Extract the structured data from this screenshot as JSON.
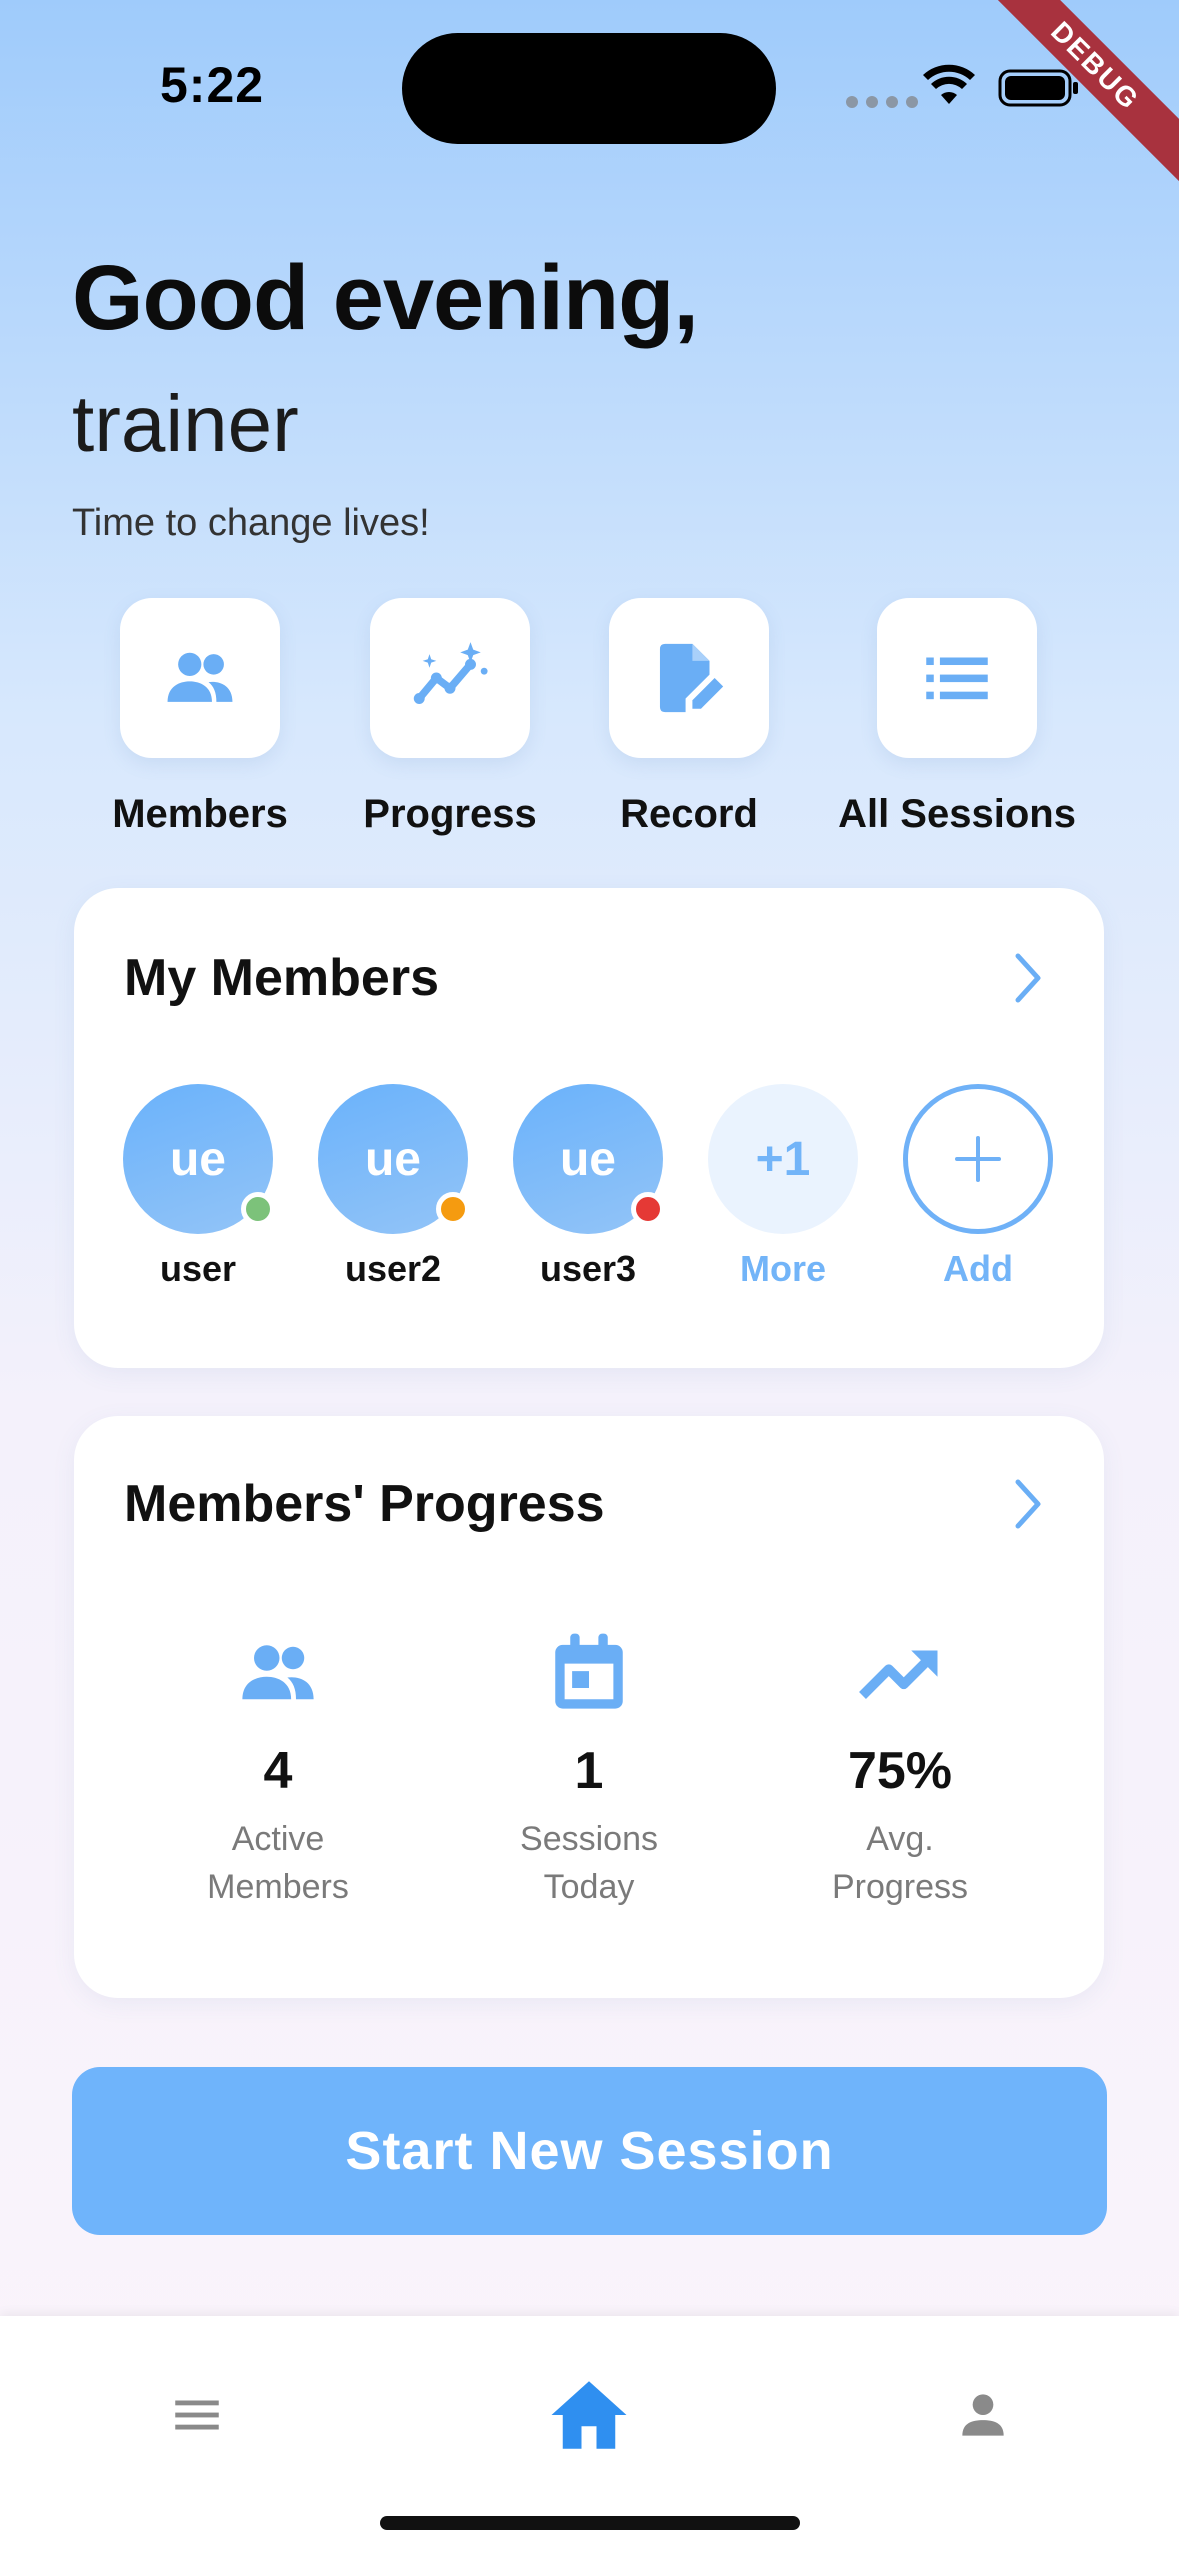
{
  "status_bar": {
    "time": "5:22",
    "debug_label": "DEBUG"
  },
  "header": {
    "greeting": "Good evening,",
    "username": "trainer",
    "tagline": "Time to change lives!"
  },
  "quick_actions": [
    {
      "label": "Members",
      "icon": "group-icon"
    },
    {
      "label": "Progress",
      "icon": "progress-chart-icon"
    },
    {
      "label": "Record",
      "icon": "edit-document-icon"
    },
    {
      "label": "All Sessions",
      "icon": "list-icon"
    }
  ],
  "my_members": {
    "title": "My Members",
    "members": [
      {
        "initials": "ue",
        "name": "user",
        "status_color": "#7cc27a"
      },
      {
        "initials": "ue",
        "name": "user2",
        "status_color": "#f59b10"
      },
      {
        "initials": "ue",
        "name": "user3",
        "status_color": "#e53935"
      }
    ],
    "more": {
      "initials": "+1",
      "label": "More"
    },
    "add": {
      "symbol": "+",
      "label": "Add"
    }
  },
  "progress": {
    "title": "Members' Progress",
    "stats": [
      {
        "value": "4",
        "label_line1": "Active",
        "label_line2": "Members",
        "icon": "group-icon"
      },
      {
        "value": "1",
        "label_line1": "Sessions",
        "label_line2": "Today",
        "icon": "calendar-icon"
      },
      {
        "value": "75%",
        "label_line1": "Avg.",
        "label_line2": "Progress",
        "icon": "trending-up-icon"
      }
    ]
  },
  "cta": {
    "label": "Start New Session"
  },
  "colors": {
    "accent": "#6fb4fb",
    "icon_blue": "#6aaef5",
    "nav_active": "#2f8ff0",
    "nav_inactive": "#8a8a8a"
  },
  "bottom_nav": [
    {
      "icon": "menu-icon",
      "active": false
    },
    {
      "icon": "home-icon",
      "active": true
    },
    {
      "icon": "person-icon",
      "active": false
    }
  ]
}
